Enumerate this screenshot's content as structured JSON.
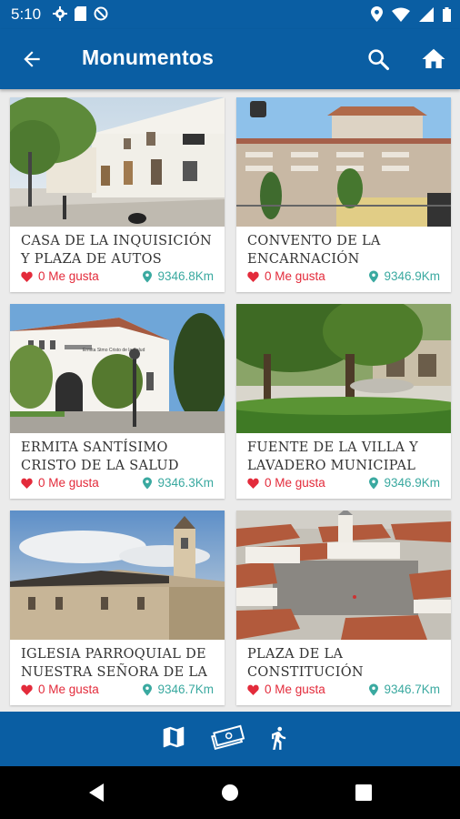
{
  "status": {
    "time": "5:10"
  },
  "appbar": {
    "title": "Monumentos"
  },
  "cards": [
    {
      "name": "CASA DE LA INQUISICIÓN Y PLAZA DE AUTOS",
      "likes": "0 Me gusta",
      "distance": "9346.8Km"
    },
    {
      "name": "CONVENTO DE LA ENCARNACIÓN",
      "likes": "0 Me gusta",
      "distance": "9346.9Km"
    },
    {
      "name": "ERMITA SANTÍSIMO CRISTO DE LA SALUD",
      "likes": "0 Me gusta",
      "distance": "9346.3Km"
    },
    {
      "name": "FUENTE DE LA VILLA Y LAVADERO MUNICIPAL",
      "likes": "0 Me gusta",
      "distance": "9346.9Km"
    },
    {
      "name": "IGLESIA PARROQUIAL DE NUESTRA SEÑORA DE LA",
      "likes": "0 Me gusta",
      "distance": "9346.7Km"
    },
    {
      "name": "PLAZA DE LA CONSTITUCIÓN",
      "likes": "0 Me gusta",
      "distance": "9346.7Km"
    }
  ],
  "image_sign": "Ermita Stmo Cristo de la Salud",
  "colors": {
    "primary": "#0a5ea3",
    "like": "#e32b3b",
    "distance": "#3aa9a0"
  }
}
